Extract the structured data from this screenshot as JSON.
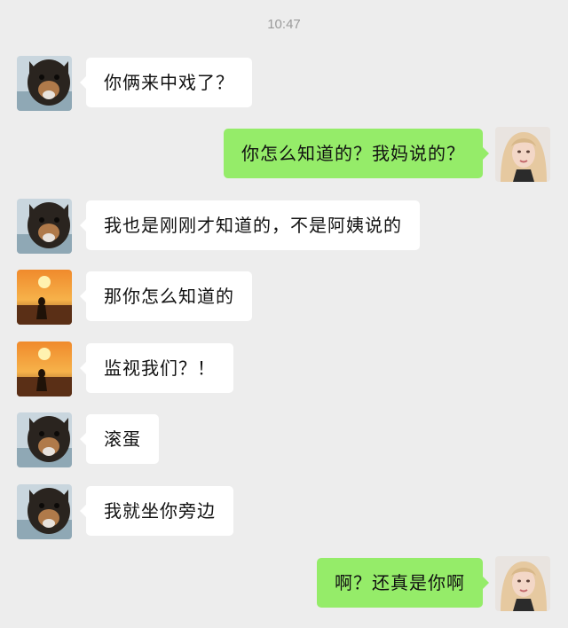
{
  "chat": {
    "timestamp": "10:47",
    "messages": [
      {
        "side": "left",
        "avatar": "dog-avatar",
        "text": "你俩来中戏了？"
      },
      {
        "side": "right",
        "avatar": "blonde-avatar",
        "text": "你怎么知道的？我妈说的？"
      },
      {
        "side": "left",
        "avatar": "dog-avatar",
        "text": "我也是刚刚才知道的，不是阿姨说的"
      },
      {
        "side": "left",
        "avatar": "sunset-avatar",
        "text": "那你怎么知道的"
      },
      {
        "side": "left",
        "avatar": "sunset-avatar",
        "text": "监视我们？！"
      },
      {
        "side": "left",
        "avatar": "dog-avatar",
        "text": "滚蛋"
      },
      {
        "side": "left",
        "avatar": "dog-avatar",
        "text": "我就坐你旁边"
      },
      {
        "side": "right",
        "avatar": "blonde-avatar",
        "text": "啊？还真是你啊"
      }
    ]
  },
  "colors": {
    "background": "#ededed",
    "incoming_bubble": "#ffffff",
    "outgoing_bubble": "#95ec69",
    "timestamp_text": "#9a9a9a"
  }
}
